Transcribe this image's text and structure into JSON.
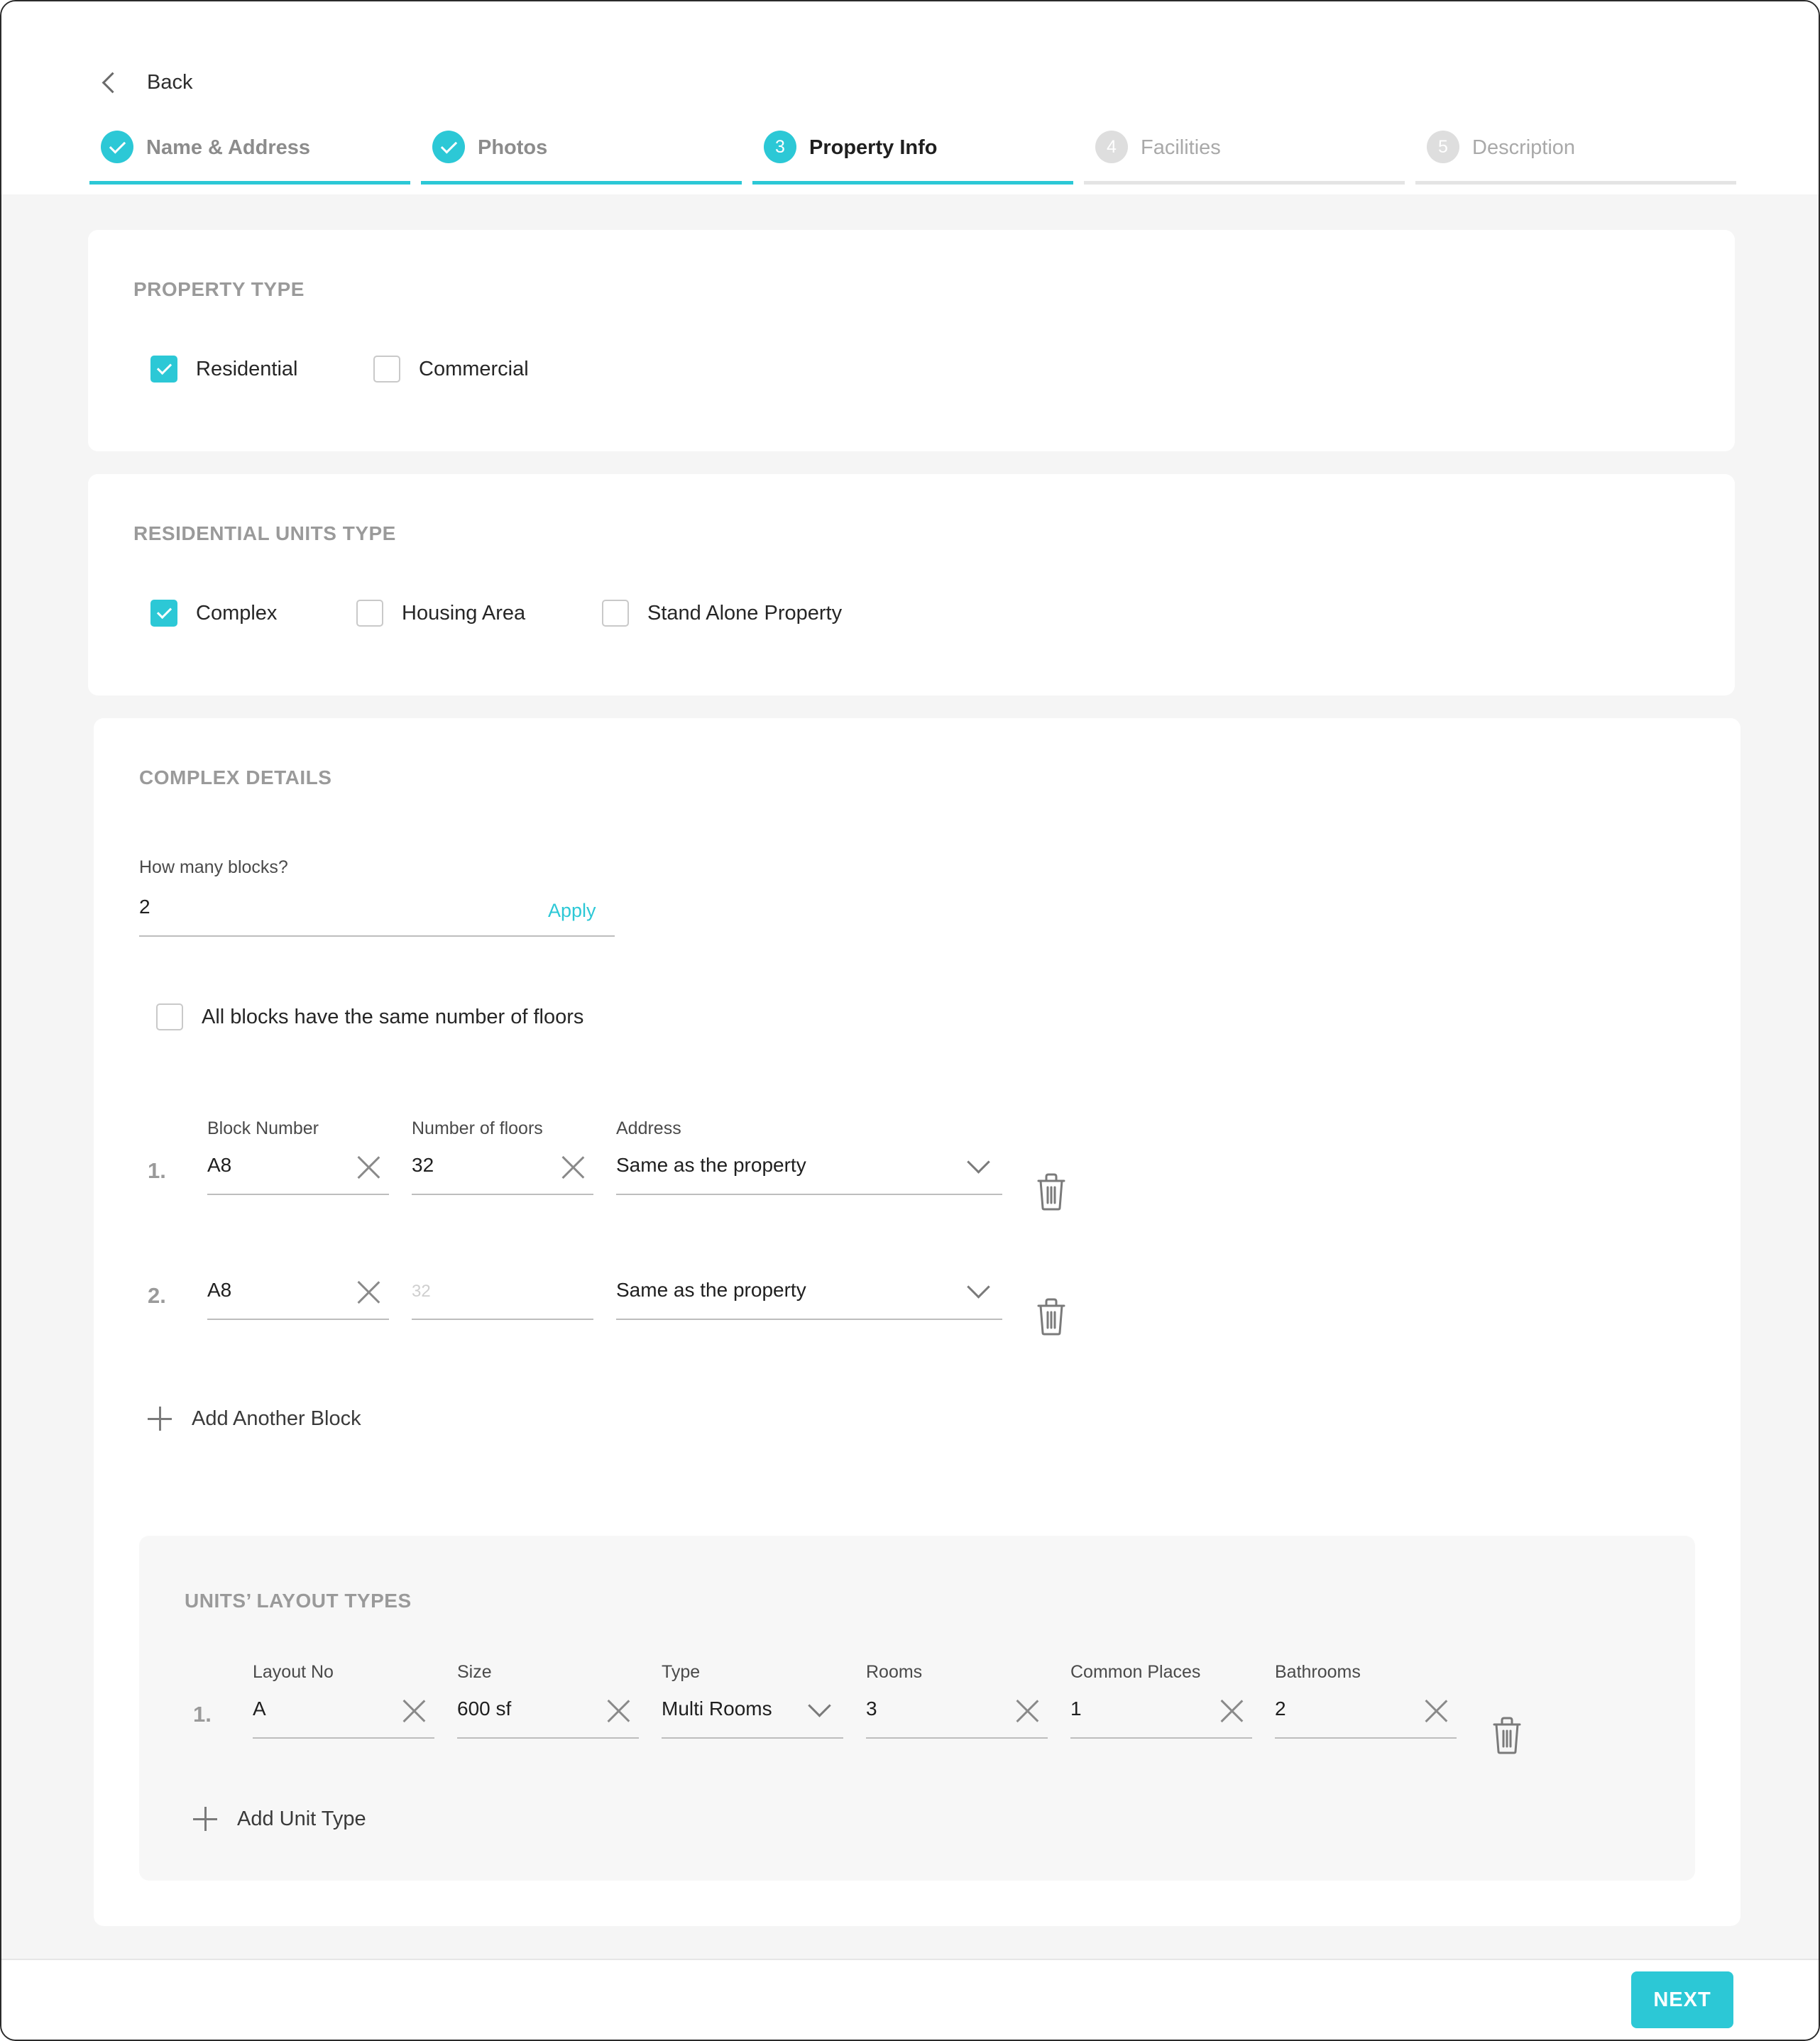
{
  "nav": {
    "back_label": "Back"
  },
  "steps": [
    {
      "number": "1",
      "label": "Name & Address",
      "state": "done"
    },
    {
      "number": "2",
      "label": "Photos",
      "state": "done"
    },
    {
      "number": "3",
      "label": "Property Info",
      "state": "active"
    },
    {
      "number": "4",
      "label": "Facilities",
      "state": "todo"
    },
    {
      "number": "5",
      "label": "Description",
      "state": "todo"
    }
  ],
  "property_type": {
    "title": "PROPERTY TYPE",
    "options": [
      {
        "label": "Residential",
        "checked": true
      },
      {
        "label": "Commercial",
        "checked": false
      }
    ]
  },
  "residential_units": {
    "title": "RESIDENTIAL UNITS TYPE",
    "options": [
      {
        "label": "Complex",
        "checked": true
      },
      {
        "label": "Housing Area",
        "checked": false
      },
      {
        "label": "Stand Alone Property",
        "checked": false
      }
    ]
  },
  "complex": {
    "title": "COMPLEX DETAILS",
    "blocks_question": "How many blocks?",
    "blocks_value": "2",
    "apply_label": "Apply",
    "same_floors_label": "All blocks have the same number of floors",
    "same_floors_checked": false,
    "columns": {
      "block_number": "Block Number",
      "floors": "Number of floors",
      "address": "Address"
    },
    "blocks": [
      {
        "num": "1.",
        "block_number": "A8",
        "floors": "32",
        "floors_placeholder": "",
        "address": "Same as the property"
      },
      {
        "num": "2.",
        "block_number": "A8",
        "floors": "",
        "floors_placeholder": "32",
        "address": "Same as the property"
      }
    ],
    "add_block_label": "Add Another Block"
  },
  "units_layout": {
    "title": "UNITS’ LAYOUT TYPES",
    "columns": {
      "layout_no": "Layout No",
      "size": "Size",
      "type": "Type",
      "rooms": "Rooms",
      "common_places": "Common Places",
      "bathrooms": "Bathrooms"
    },
    "rows": [
      {
        "num": "1.",
        "layout_no": "A",
        "size": "600 sf",
        "type": "Multi Rooms",
        "rooms": "3",
        "common_places": "1",
        "bathrooms": "2"
      }
    ],
    "add_label": "Add Unit Type"
  },
  "footer": {
    "next_label": "NEXT"
  },
  "colors": {
    "accent": "#2cc8d6",
    "background": "#f5f5f5",
    "card": "#ffffff",
    "muted_text": "#9a9a9a"
  }
}
